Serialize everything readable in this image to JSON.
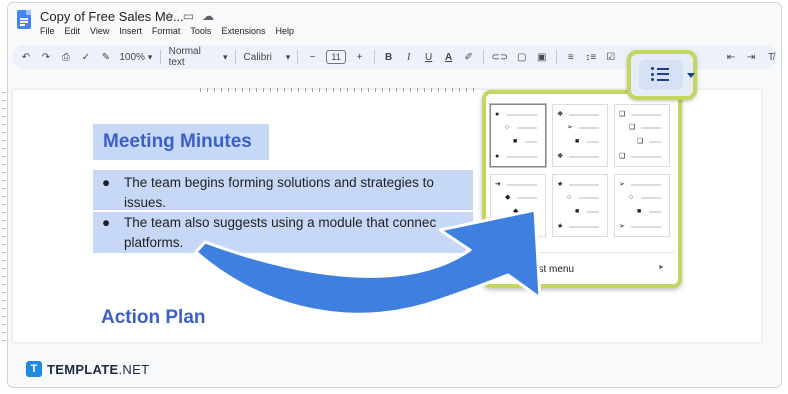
{
  "app": {
    "document_title": "Copy of Free Sales Me...",
    "title_icons": [
      "star-icon",
      "folder-move-icon",
      "cloud-status-icon"
    ],
    "menu": [
      "File",
      "Edit",
      "View",
      "Insert",
      "Format",
      "Tools",
      "Extensions",
      "Help"
    ]
  },
  "toolbar": {
    "zoom": "100%",
    "style": "Normal text",
    "font": "Calibri",
    "font_size": "11",
    "minus": "−",
    "plus": "+",
    "bold": "B",
    "italic": "I",
    "underline": "U",
    "text_color": "A"
  },
  "document": {
    "heading": "Meeting Minutes",
    "bullets": [
      {
        "line1": "The team begins forming solutions and strategies to",
        "line2": "issues."
      },
      {
        "line1": "The team also suggests using a module that connec",
        "line2": "platforms."
      }
    ],
    "bullet_glyph": "●",
    "section2": "Action Plan"
  },
  "bullet_menu": {
    "checklist_label": "cklist menu",
    "submenu_arrow": "►"
  },
  "footer": {
    "logo_letter": "T",
    "brand": "TEMPLATE",
    "brand_suffix": ".NET"
  },
  "colors": {
    "highlight": "#c3d660",
    "heading": "#3c5fc9",
    "selection": "#c6d8f5",
    "arrow": "#3f7fe0"
  }
}
